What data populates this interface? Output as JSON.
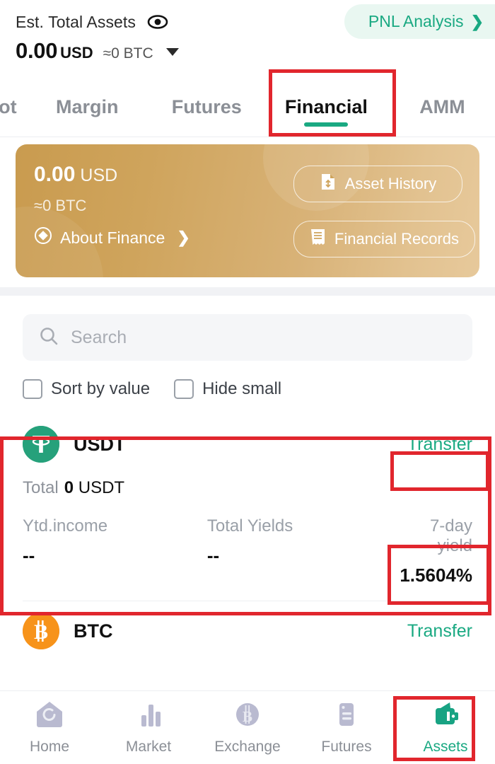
{
  "header": {
    "label": "Est. Total Assets",
    "eye_icon": "eye-icon",
    "amount": "0.00",
    "currency": "USD",
    "btc_equiv": "≈0 BTC",
    "caret_icon": "chevron-down-icon",
    "pnl_label": "PNL Analysis",
    "pnl_chevron": "❯"
  },
  "tabs": [
    {
      "label": "ot",
      "active": false
    },
    {
      "label": "Margin",
      "active": false
    },
    {
      "label": "Futures",
      "active": false
    },
    {
      "label": "Financial",
      "active": true
    },
    {
      "label": "AMM",
      "active": false
    }
  ],
  "balance_card": {
    "amount": "0.00",
    "currency": "USD",
    "btc_equiv": "≈0  BTC",
    "about_label": "About Finance",
    "about_chevron": "❯",
    "about_icon": "diamond-circle-icon",
    "asset_history_label": "Asset History",
    "asset_history_icon": "document-transfer-icon",
    "financial_records_label": "Financial Records",
    "financial_records_icon": "receipt-icon"
  },
  "search": {
    "placeholder": "Search",
    "value": "",
    "icon": "search-icon"
  },
  "filters": [
    {
      "label": "Sort by value",
      "checked": false
    },
    {
      "label": "Hide small",
      "checked": false
    }
  ],
  "assets": [
    {
      "symbol": "USDT",
      "icon": "usdt-coin-icon",
      "transfer_label": "Transfer",
      "total_label": "Total",
      "total_value": "0",
      "total_unit": "USDT",
      "metrics": [
        {
          "label": "Ytd.income",
          "value": "--"
        },
        {
          "label": "Total Yields",
          "value": "--"
        },
        {
          "label": "7-day yield",
          "value": "1.5604%"
        }
      ]
    },
    {
      "symbol": "BTC",
      "icon": "btc-coin-icon",
      "transfer_label": "Transfer"
    }
  ],
  "bottom_nav": [
    {
      "label": "Home",
      "icon": "home-icon",
      "active": false
    },
    {
      "label": "Market",
      "icon": "bar-chart-icon",
      "active": false
    },
    {
      "label": "Exchange",
      "icon": "bitcoin-circle-icon",
      "active": false
    },
    {
      "label": "Futures",
      "icon": "document-lines-icon",
      "active": false
    },
    {
      "label": "Assets",
      "icon": "wallet-icon",
      "active": true
    }
  ],
  "colors": {
    "accent_teal": "#1aa982",
    "annotation_red": "#e1262d",
    "usdt_green": "#26a17b",
    "btc_orange": "#f7931a",
    "gold_card_start": "#c99b4f",
    "gold_card_end": "#e7c99b",
    "nav_inactive": "#b9bad0"
  }
}
